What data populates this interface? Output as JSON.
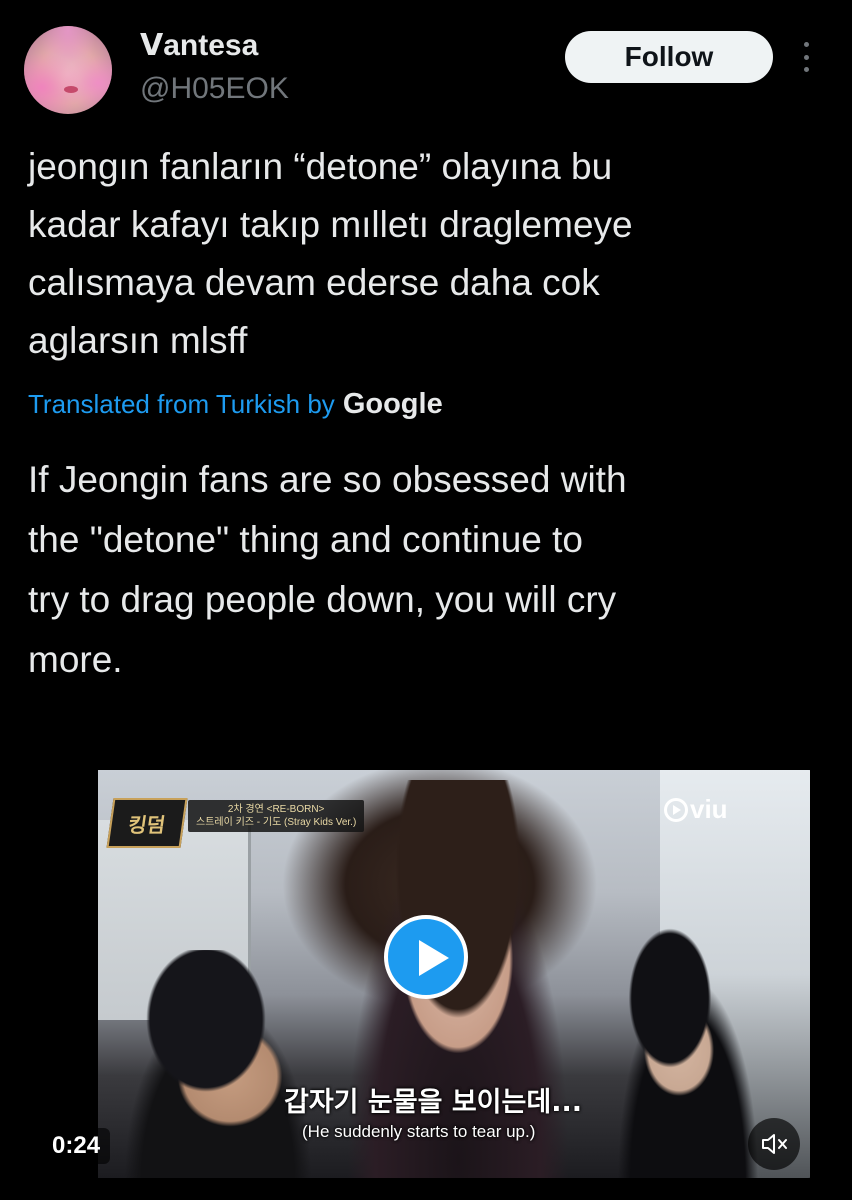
{
  "user": {
    "display_name": "ᐯantesa",
    "handle": "@H05EOK",
    "avatar_icon": "avatar-photo"
  },
  "header": {
    "follow_label": "Follow",
    "more_icon": "more-icon"
  },
  "tweet": {
    "text": "jeongın fanların “detone” olayına bu\nkadar kafayı takıp mılletı draglemeye\ncalısmaya devam ederse daha cok\naglarsın mlsff",
    "translated_from": "Translated from Turkish by",
    "translator": "Google",
    "translation": "If Jeongin fans are so obsessed with\nthe \"detone\" thing and continue to\ntry to drag people down, you will cry\nmore."
  },
  "video": {
    "show_logo_text": "킹덤",
    "show_caption_line1": "2차 경연 <RE-BORN>",
    "show_caption_line2": "스트레이 키즈 - 기도 (Stray Kids Ver.)",
    "watermark": "viu",
    "subtitle_ko": "갑자기 눈물을 보이는데...",
    "subtitle_en": "(He suddenly starts to tear up.)",
    "time": "0:24",
    "play_icon": "play-icon",
    "mute_icon": "mute-icon",
    "accent_color": "#1d9bf0"
  }
}
